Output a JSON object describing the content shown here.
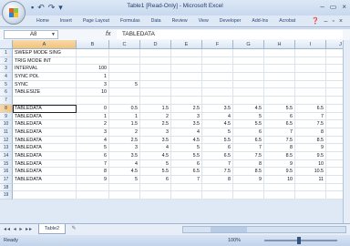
{
  "window": {
    "title": "Table1  [Read-Only]  -  Microsoft Excel",
    "controls": [
      "–",
      "▭",
      "×"
    ]
  },
  "ribbon": {
    "tabs": [
      "Home",
      "Insert",
      "Page Layout",
      "Formulas",
      "Data",
      "Review",
      "View",
      "Developer",
      "Add-Ins",
      "Acrobat"
    ]
  },
  "formula_bar": {
    "name_box": "A8",
    "fx": "fx",
    "value": "TABLEDATA"
  },
  "columns": [
    "A",
    "B",
    "C",
    "D",
    "E",
    "F",
    "G",
    "H",
    "I",
    "J"
  ],
  "rows": [
    {
      "n": "1",
      "cells": [
        "SWEEP MODE SING",
        "",
        "",
        "",
        "",
        "",
        "",
        "",
        "",
        ""
      ]
    },
    {
      "n": "2",
      "cells": [
        "TRIG MODE INT",
        "",
        "",
        "",
        "",
        "",
        "",
        "",
        "",
        ""
      ]
    },
    {
      "n": "3",
      "cells": [
        "INTERVAL",
        "100",
        "",
        "",
        "",
        "",
        "",
        "",
        "",
        ""
      ]
    },
    {
      "n": "4",
      "cells": [
        "SYNC POL",
        "1",
        "",
        "",
        "",
        "",
        "",
        "",
        "",
        ""
      ]
    },
    {
      "n": "5",
      "cells": [
        "SYNC",
        "3",
        "5",
        "",
        "",
        "",
        "",
        "",
        "",
        ""
      ]
    },
    {
      "n": "6",
      "cells": [
        "TABLESIZE",
        "10",
        "",
        "",
        "",
        "",
        "",
        "",
        "",
        ""
      ]
    },
    {
      "n": "7",
      "cells": [
        "",
        "",
        "",
        "",
        "",
        "",
        "",
        "",
        "",
        ""
      ]
    },
    {
      "n": "8",
      "cells": [
        "TABLEDATA",
        "0",
        "0.5",
        "1.5",
        "2.5",
        "3.5",
        "4.5",
        "5.5",
        "6.5",
        "7.5"
      ]
    },
    {
      "n": "9",
      "cells": [
        "TABLEDATA",
        "1",
        "1",
        "2",
        "3",
        "4",
        "5",
        "6",
        "7",
        "8"
      ]
    },
    {
      "n": "10",
      "cells": [
        "TABLEDATA",
        "2",
        "1.5",
        "2.5",
        "3.5",
        "4.5",
        "5.5",
        "6.5",
        "7.5",
        "8.5"
      ]
    },
    {
      "n": "11",
      "cells": [
        "TABLEDATA",
        "3",
        "2",
        "3",
        "4",
        "5",
        "6",
        "7",
        "8",
        "9"
      ]
    },
    {
      "n": "12",
      "cells": [
        "TABLEDATA",
        "4",
        "2.5",
        "3.5",
        "4.5",
        "5.5",
        "6.5",
        "7.5",
        "8.5",
        "9.5"
      ]
    },
    {
      "n": "13",
      "cells": [
        "TABLEDATA",
        "5",
        "3",
        "4",
        "5",
        "6",
        "7",
        "8",
        "9",
        "10"
      ]
    },
    {
      "n": "14",
      "cells": [
        "TABLEDATA",
        "6",
        "3.5",
        "4.5",
        "5.5",
        "6.5",
        "7.5",
        "8.5",
        "9.5",
        "10.5"
      ]
    },
    {
      "n": "15",
      "cells": [
        "TABLEDATA",
        "7",
        "4",
        "5",
        "6",
        "7",
        "8",
        "9",
        "10",
        "11"
      ]
    },
    {
      "n": "16",
      "cells": [
        "TABLEDATA",
        "8",
        "4.5",
        "5.5",
        "6.5",
        "7.5",
        "8.5",
        "9.5",
        "10.5",
        "11.5"
      ]
    },
    {
      "n": "17",
      "cells": [
        "TABLEDATA",
        "9",
        "5",
        "6",
        "7",
        "8",
        "9",
        "10",
        "11",
        "12"
      ]
    },
    {
      "n": "18",
      "cells": [
        "",
        "",
        "",
        "",
        "",
        "",
        "",
        "",
        "",
        ""
      ]
    },
    {
      "n": "19",
      "cells": [
        "",
        "",
        "",
        "",
        "",
        "",
        "",
        "",
        "",
        ""
      ]
    }
  ],
  "sheet": {
    "tab": "Table2"
  },
  "status": {
    "ready": "Ready",
    "zoom": "100%"
  },
  "colors": {
    "ribbon_bg": "#dfe9f5",
    "selected_header": "#f3c27a"
  }
}
